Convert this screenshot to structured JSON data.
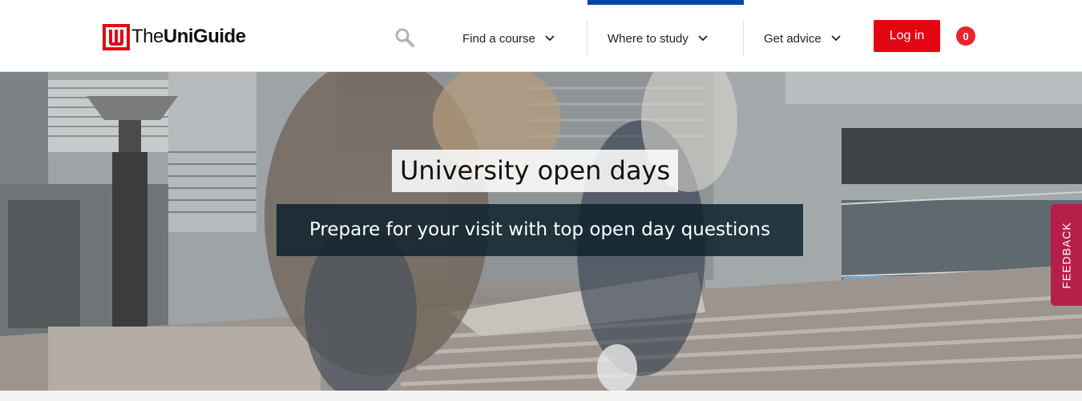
{
  "header": {
    "logo": {
      "text_light": "The",
      "text_bold": "UniGuide"
    },
    "search_icon": "search-icon",
    "nav": [
      {
        "label": "Find a course",
        "icon": "chevron-down-icon"
      },
      {
        "label": "Where to study",
        "icon": "chevron-down-icon"
      },
      {
        "label": "Get advice",
        "icon": "chevron-down-icon"
      }
    ],
    "login_label": "Log in",
    "basket_count": "0"
  },
  "hero": {
    "title": "University open days",
    "subtitle": "Prepare for your visit with top open day questions"
  },
  "feedback_label": "FEEDBACK",
  "colors": {
    "brand_red": "#e30613",
    "nav_active": "#0047a8",
    "feedback": "#b61f4a",
    "subtitle_bg": "#0c202c"
  }
}
